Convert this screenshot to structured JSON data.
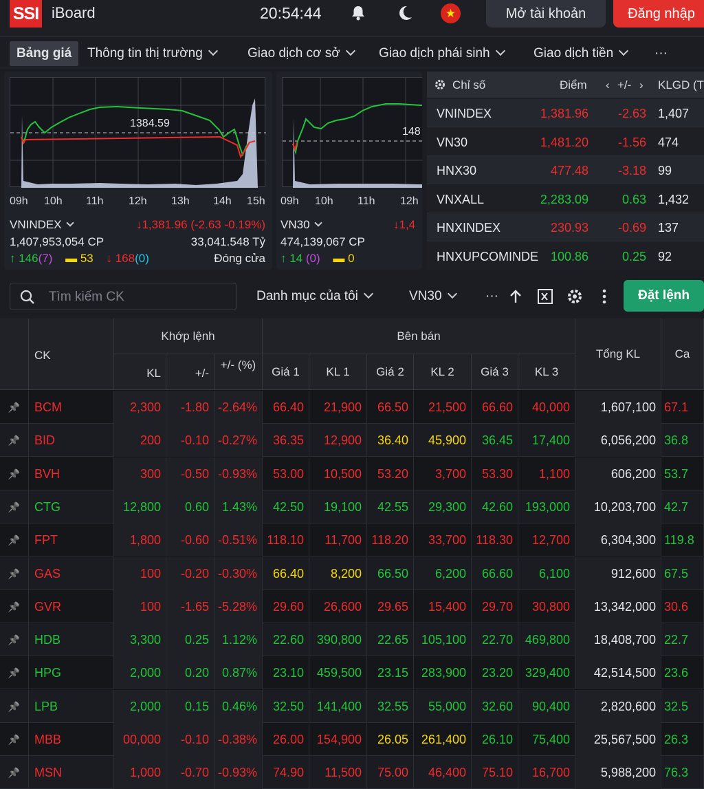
{
  "header": {
    "logo": "SSI",
    "app_name": "iBoard",
    "clock": "20:54:44",
    "open_account": "Mở tài khoản",
    "login": "Đăng nhập"
  },
  "nav": {
    "items": [
      "Bảng giá",
      "Thông tin thị trường",
      "Giao dịch cơ sở",
      "Giao dịch phái sinh",
      "Giao dịch tiền",
      "···"
    ]
  },
  "chart1": {
    "ref_label": "1384.59",
    "ticks": [
      "09h",
      "10h",
      "11h",
      "12h",
      "13h",
      "14h",
      "15h"
    ],
    "name": "VNINDEX",
    "change": "↓1,381.96 (-2.63 -0.19%)",
    "volume": "1,407,953,054 CP",
    "value": "33,041.548 Tỷ",
    "up": "↑ 146",
    "up_ceiling": "(7)",
    "flat": "53",
    "down": "↓ 168",
    "down_floor": "(0)",
    "status": "Đóng cửa"
  },
  "chart2": {
    "ref_label": "148",
    "ticks": [
      "09h",
      "10h",
      "11h",
      "12h"
    ],
    "name": "VN30",
    "change": "↓1,4",
    "volume": "474,139,067 CP",
    "up": "↑ 14",
    "up_ceiling": "(0)",
    "flat": "0"
  },
  "index_table": {
    "headers": {
      "name": "Chỉ số",
      "point": "Điểm",
      "change": "+/-",
      "volume": "KLGD (T"
    },
    "rows": [
      {
        "name": "VNINDEX",
        "point": "1,381.96",
        "change": "-2.63",
        "volume": "1,407",
        "color": "red"
      },
      {
        "name": "VN30",
        "point": "1,481.20",
        "change": "-1.56",
        "volume": "474",
        "color": "red"
      },
      {
        "name": "HNX30",
        "point": "477.48",
        "change": "-3.18",
        "volume": "99",
        "color": "red"
      },
      {
        "name": "VNXALL",
        "point": "2,283.09",
        "change": "0.63",
        "volume": "1,432",
        "color": "green"
      },
      {
        "name": "HNXINDEX",
        "point": "230.93",
        "change": "-0.69",
        "volume": "137",
        "color": "red"
      },
      {
        "name": "HNXUPCOMINDE",
        "point": "100.86",
        "change": "0.25",
        "volume": "92",
        "color": "green"
      }
    ]
  },
  "toolbar": {
    "search_placeholder": "Tìm kiếm CK",
    "watchlist": "Danh mục của tôi",
    "group": "VN30",
    "more": "···",
    "order": "Đặt lệnh"
  },
  "board": {
    "headers": {
      "symbol": "CK",
      "matched": "Khớp lệnh",
      "sell": "Bên bán",
      "kl": "KL",
      "change": "+/-",
      "pct": "+/- (%)",
      "p1": "Giá 1",
      "v1": "KL 1",
      "p2": "Giá 2",
      "v2": "KL 2",
      "p3": "Giá 3",
      "v3": "KL 3",
      "total": "Tổng KL",
      "extra": "Ca"
    },
    "colors": {
      "red": "#ef2b2b",
      "green": "#22c43a",
      "yellow": "#f5d60a"
    },
    "rows": [
      {
        "s": "BCM",
        "c": "red",
        "kl": "2,300",
        "ch": "-1.80",
        "pct": "-2.64%",
        "p1": "66.40",
        "v1": "21,900",
        "c1": "red",
        "p2": "66.50",
        "v2": "21,500",
        "c2": "red",
        "p3": "66.60",
        "v3": "40,000",
        "c3": "red",
        "total": "1,607,100",
        "x": "67.1",
        "cx": "red"
      },
      {
        "s": "BID",
        "c": "red",
        "kl": "200",
        "ch": "-0.10",
        "pct": "-0.27%",
        "p1": "36.35",
        "v1": "12,900",
        "c1": "red",
        "p2": "36.40",
        "v2": "45,900",
        "c2": "yellow",
        "p3": "36.45",
        "v3": "17,400",
        "c3": "green",
        "total": "6,056,200",
        "x": "36.8",
        "cx": "green"
      },
      {
        "s": "BVH",
        "c": "red",
        "kl": "300",
        "ch": "-0.50",
        "pct": "-0.93%",
        "p1": "53.00",
        "v1": "10,500",
        "c1": "red",
        "p2": "53.20",
        "v2": "3,700",
        "c2": "red",
        "p3": "53.30",
        "v3": "1,100",
        "c3": "red",
        "total": "606,200",
        "x": "53.7",
        "cx": "green"
      },
      {
        "s": "CTG",
        "c": "green",
        "kl": "12,800",
        "ch": "0.60",
        "pct": "1.43%",
        "p1": "42.50",
        "v1": "19,100",
        "c1": "green",
        "p2": "42.55",
        "v2": "29,300",
        "c2": "green",
        "p3": "42.60",
        "v3": "193,000",
        "c3": "green",
        "total": "10,203,700",
        "x": "42.7",
        "cx": "green"
      },
      {
        "s": "FPT",
        "c": "red",
        "kl": "1,800",
        "ch": "-0.60",
        "pct": "-0.51%",
        "p1": "118.10",
        "v1": "11,700",
        "c1": "red",
        "p2": "118.20",
        "v2": "33,700",
        "c2": "red",
        "p3": "118.30",
        "v3": "12,700",
        "c3": "red",
        "total": "6,304,300",
        "x": "119.8",
        "cx": "green"
      },
      {
        "s": "GAS",
        "c": "red",
        "kl": "100",
        "ch": "-0.20",
        "pct": "-0.30%",
        "p1": "66.40",
        "v1": "8,200",
        "c1": "yellow",
        "p2": "66.50",
        "v2": "6,200",
        "c2": "green",
        "p3": "66.60",
        "v3": "6,100",
        "c3": "green",
        "total": "912,600",
        "x": "67.5",
        "cx": "green"
      },
      {
        "s": "GVR",
        "c": "red",
        "kl": "100",
        "ch": "-1.65",
        "pct": "-5.28%",
        "p1": "29.60",
        "v1": "26,600",
        "c1": "red",
        "p2": "29.65",
        "v2": "15,400",
        "c2": "red",
        "p3": "29.70",
        "v3": "30,800",
        "c3": "red",
        "total": "13,342,000",
        "x": "30.6",
        "cx": "red"
      },
      {
        "s": "HDB",
        "c": "green",
        "kl": "3,300",
        "ch": "0.25",
        "pct": "1.12%",
        "p1": "22.60",
        "v1": "390,800",
        "c1": "green",
        "p2": "22.65",
        "v2": "105,100",
        "c2": "green",
        "p3": "22.70",
        "v3": "469,800",
        "c3": "green",
        "total": "18,408,700",
        "x": "22.7",
        "cx": "green"
      },
      {
        "s": "HPG",
        "c": "green",
        "kl": "2,000",
        "ch": "0.20",
        "pct": "0.87%",
        "p1": "23.10",
        "v1": "459,500",
        "c1": "green",
        "p2": "23.15",
        "v2": "283,900",
        "c2": "green",
        "p3": "23.20",
        "v3": "329,400",
        "c3": "green",
        "total": "42,514,500",
        "x": "23.6",
        "cx": "green"
      },
      {
        "s": "LPB",
        "c": "green",
        "kl": "2,000",
        "ch": "0.15",
        "pct": "0.46%",
        "p1": "32.50",
        "v1": "141,400",
        "c1": "green",
        "p2": "32.55",
        "v2": "55,000",
        "c2": "green",
        "p3": "32.60",
        "v3": "90,400",
        "c3": "green",
        "total": "2,820,600",
        "x": "32.5",
        "cx": "green"
      },
      {
        "s": "MBB",
        "c": "red",
        "kl": "00,000",
        "ch": "-0.10",
        "pct": "-0.38%",
        "p1": "26.00",
        "v1": "154,900",
        "c1": "red",
        "p2": "26.05",
        "v2": "261,400",
        "c2": "yellow",
        "p3": "26.10",
        "v3": "75,400",
        "c3": "green",
        "total": "25,567,500",
        "x": "26.3",
        "cx": "green"
      },
      {
        "s": "MSN",
        "c": "red",
        "kl": "1,000",
        "ch": "-0.70",
        "pct": "-0.93%",
        "p1": "74.90",
        "v1": "11,500",
        "c1": "red",
        "p2": "75.00",
        "v2": "46,400",
        "c2": "red",
        "p3": "75.10",
        "v3": "16,700",
        "c3": "red",
        "total": "5,988,200",
        "x": "76.3",
        "cx": "green"
      }
    ]
  }
}
